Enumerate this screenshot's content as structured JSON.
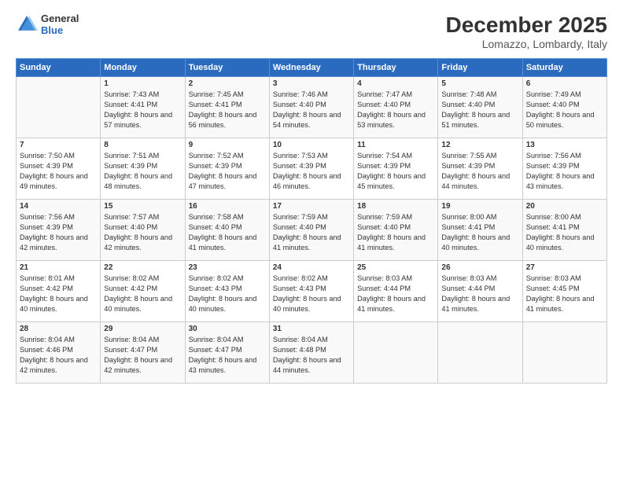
{
  "logo": {
    "line1": "General",
    "line2": "Blue"
  },
  "title": "December 2025",
  "subtitle": "Lomazzo, Lombardy, Italy",
  "headers": [
    "Sunday",
    "Monday",
    "Tuesday",
    "Wednesday",
    "Thursday",
    "Friday",
    "Saturday"
  ],
  "weeks": [
    [
      {
        "day": "",
        "sunrise": "",
        "sunset": "",
        "daylight": ""
      },
      {
        "day": "1",
        "sunrise": "Sunrise: 7:43 AM",
        "sunset": "Sunset: 4:41 PM",
        "daylight": "Daylight: 8 hours and 57 minutes."
      },
      {
        "day": "2",
        "sunrise": "Sunrise: 7:45 AM",
        "sunset": "Sunset: 4:41 PM",
        "daylight": "Daylight: 8 hours and 56 minutes."
      },
      {
        "day": "3",
        "sunrise": "Sunrise: 7:46 AM",
        "sunset": "Sunset: 4:40 PM",
        "daylight": "Daylight: 8 hours and 54 minutes."
      },
      {
        "day": "4",
        "sunrise": "Sunrise: 7:47 AM",
        "sunset": "Sunset: 4:40 PM",
        "daylight": "Daylight: 8 hours and 53 minutes."
      },
      {
        "day": "5",
        "sunrise": "Sunrise: 7:48 AM",
        "sunset": "Sunset: 4:40 PM",
        "daylight": "Daylight: 8 hours and 51 minutes."
      },
      {
        "day": "6",
        "sunrise": "Sunrise: 7:49 AM",
        "sunset": "Sunset: 4:40 PM",
        "daylight": "Daylight: 8 hours and 50 minutes."
      }
    ],
    [
      {
        "day": "7",
        "sunrise": "Sunrise: 7:50 AM",
        "sunset": "Sunset: 4:39 PM",
        "daylight": "Daylight: 8 hours and 49 minutes."
      },
      {
        "day": "8",
        "sunrise": "Sunrise: 7:51 AM",
        "sunset": "Sunset: 4:39 PM",
        "daylight": "Daylight: 8 hours and 48 minutes."
      },
      {
        "day": "9",
        "sunrise": "Sunrise: 7:52 AM",
        "sunset": "Sunset: 4:39 PM",
        "daylight": "Daylight: 8 hours and 47 minutes."
      },
      {
        "day": "10",
        "sunrise": "Sunrise: 7:53 AM",
        "sunset": "Sunset: 4:39 PM",
        "daylight": "Daylight: 8 hours and 46 minutes."
      },
      {
        "day": "11",
        "sunrise": "Sunrise: 7:54 AM",
        "sunset": "Sunset: 4:39 PM",
        "daylight": "Daylight: 8 hours and 45 minutes."
      },
      {
        "day": "12",
        "sunrise": "Sunrise: 7:55 AM",
        "sunset": "Sunset: 4:39 PM",
        "daylight": "Daylight: 8 hours and 44 minutes."
      },
      {
        "day": "13",
        "sunrise": "Sunrise: 7:56 AM",
        "sunset": "Sunset: 4:39 PM",
        "daylight": "Daylight: 8 hours and 43 minutes."
      }
    ],
    [
      {
        "day": "14",
        "sunrise": "Sunrise: 7:56 AM",
        "sunset": "Sunset: 4:39 PM",
        "daylight": "Daylight: 8 hours and 42 minutes."
      },
      {
        "day": "15",
        "sunrise": "Sunrise: 7:57 AM",
        "sunset": "Sunset: 4:40 PM",
        "daylight": "Daylight: 8 hours and 42 minutes."
      },
      {
        "day": "16",
        "sunrise": "Sunrise: 7:58 AM",
        "sunset": "Sunset: 4:40 PM",
        "daylight": "Daylight: 8 hours and 41 minutes."
      },
      {
        "day": "17",
        "sunrise": "Sunrise: 7:59 AM",
        "sunset": "Sunset: 4:40 PM",
        "daylight": "Daylight: 8 hours and 41 minutes."
      },
      {
        "day": "18",
        "sunrise": "Sunrise: 7:59 AM",
        "sunset": "Sunset: 4:40 PM",
        "daylight": "Daylight: 8 hours and 41 minutes."
      },
      {
        "day": "19",
        "sunrise": "Sunrise: 8:00 AM",
        "sunset": "Sunset: 4:41 PM",
        "daylight": "Daylight: 8 hours and 40 minutes."
      },
      {
        "day": "20",
        "sunrise": "Sunrise: 8:00 AM",
        "sunset": "Sunset: 4:41 PM",
        "daylight": "Daylight: 8 hours and 40 minutes."
      }
    ],
    [
      {
        "day": "21",
        "sunrise": "Sunrise: 8:01 AM",
        "sunset": "Sunset: 4:42 PM",
        "daylight": "Daylight: 8 hours and 40 minutes."
      },
      {
        "day": "22",
        "sunrise": "Sunrise: 8:02 AM",
        "sunset": "Sunset: 4:42 PM",
        "daylight": "Daylight: 8 hours and 40 minutes."
      },
      {
        "day": "23",
        "sunrise": "Sunrise: 8:02 AM",
        "sunset": "Sunset: 4:43 PM",
        "daylight": "Daylight: 8 hours and 40 minutes."
      },
      {
        "day": "24",
        "sunrise": "Sunrise: 8:02 AM",
        "sunset": "Sunset: 4:43 PM",
        "daylight": "Daylight: 8 hours and 40 minutes."
      },
      {
        "day": "25",
        "sunrise": "Sunrise: 8:03 AM",
        "sunset": "Sunset: 4:44 PM",
        "daylight": "Daylight: 8 hours and 41 minutes."
      },
      {
        "day": "26",
        "sunrise": "Sunrise: 8:03 AM",
        "sunset": "Sunset: 4:44 PM",
        "daylight": "Daylight: 8 hours and 41 minutes."
      },
      {
        "day": "27",
        "sunrise": "Sunrise: 8:03 AM",
        "sunset": "Sunset: 4:45 PM",
        "daylight": "Daylight: 8 hours and 41 minutes."
      }
    ],
    [
      {
        "day": "28",
        "sunrise": "Sunrise: 8:04 AM",
        "sunset": "Sunset: 4:46 PM",
        "daylight": "Daylight: 8 hours and 42 minutes."
      },
      {
        "day": "29",
        "sunrise": "Sunrise: 8:04 AM",
        "sunset": "Sunset: 4:47 PM",
        "daylight": "Daylight: 8 hours and 42 minutes."
      },
      {
        "day": "30",
        "sunrise": "Sunrise: 8:04 AM",
        "sunset": "Sunset: 4:47 PM",
        "daylight": "Daylight: 8 hours and 43 minutes."
      },
      {
        "day": "31",
        "sunrise": "Sunrise: 8:04 AM",
        "sunset": "Sunset: 4:48 PM",
        "daylight": "Daylight: 8 hours and 44 minutes."
      },
      {
        "day": "",
        "sunrise": "",
        "sunset": "",
        "daylight": ""
      },
      {
        "day": "",
        "sunrise": "",
        "sunset": "",
        "daylight": ""
      },
      {
        "day": "",
        "sunrise": "",
        "sunset": "",
        "daylight": ""
      }
    ]
  ]
}
